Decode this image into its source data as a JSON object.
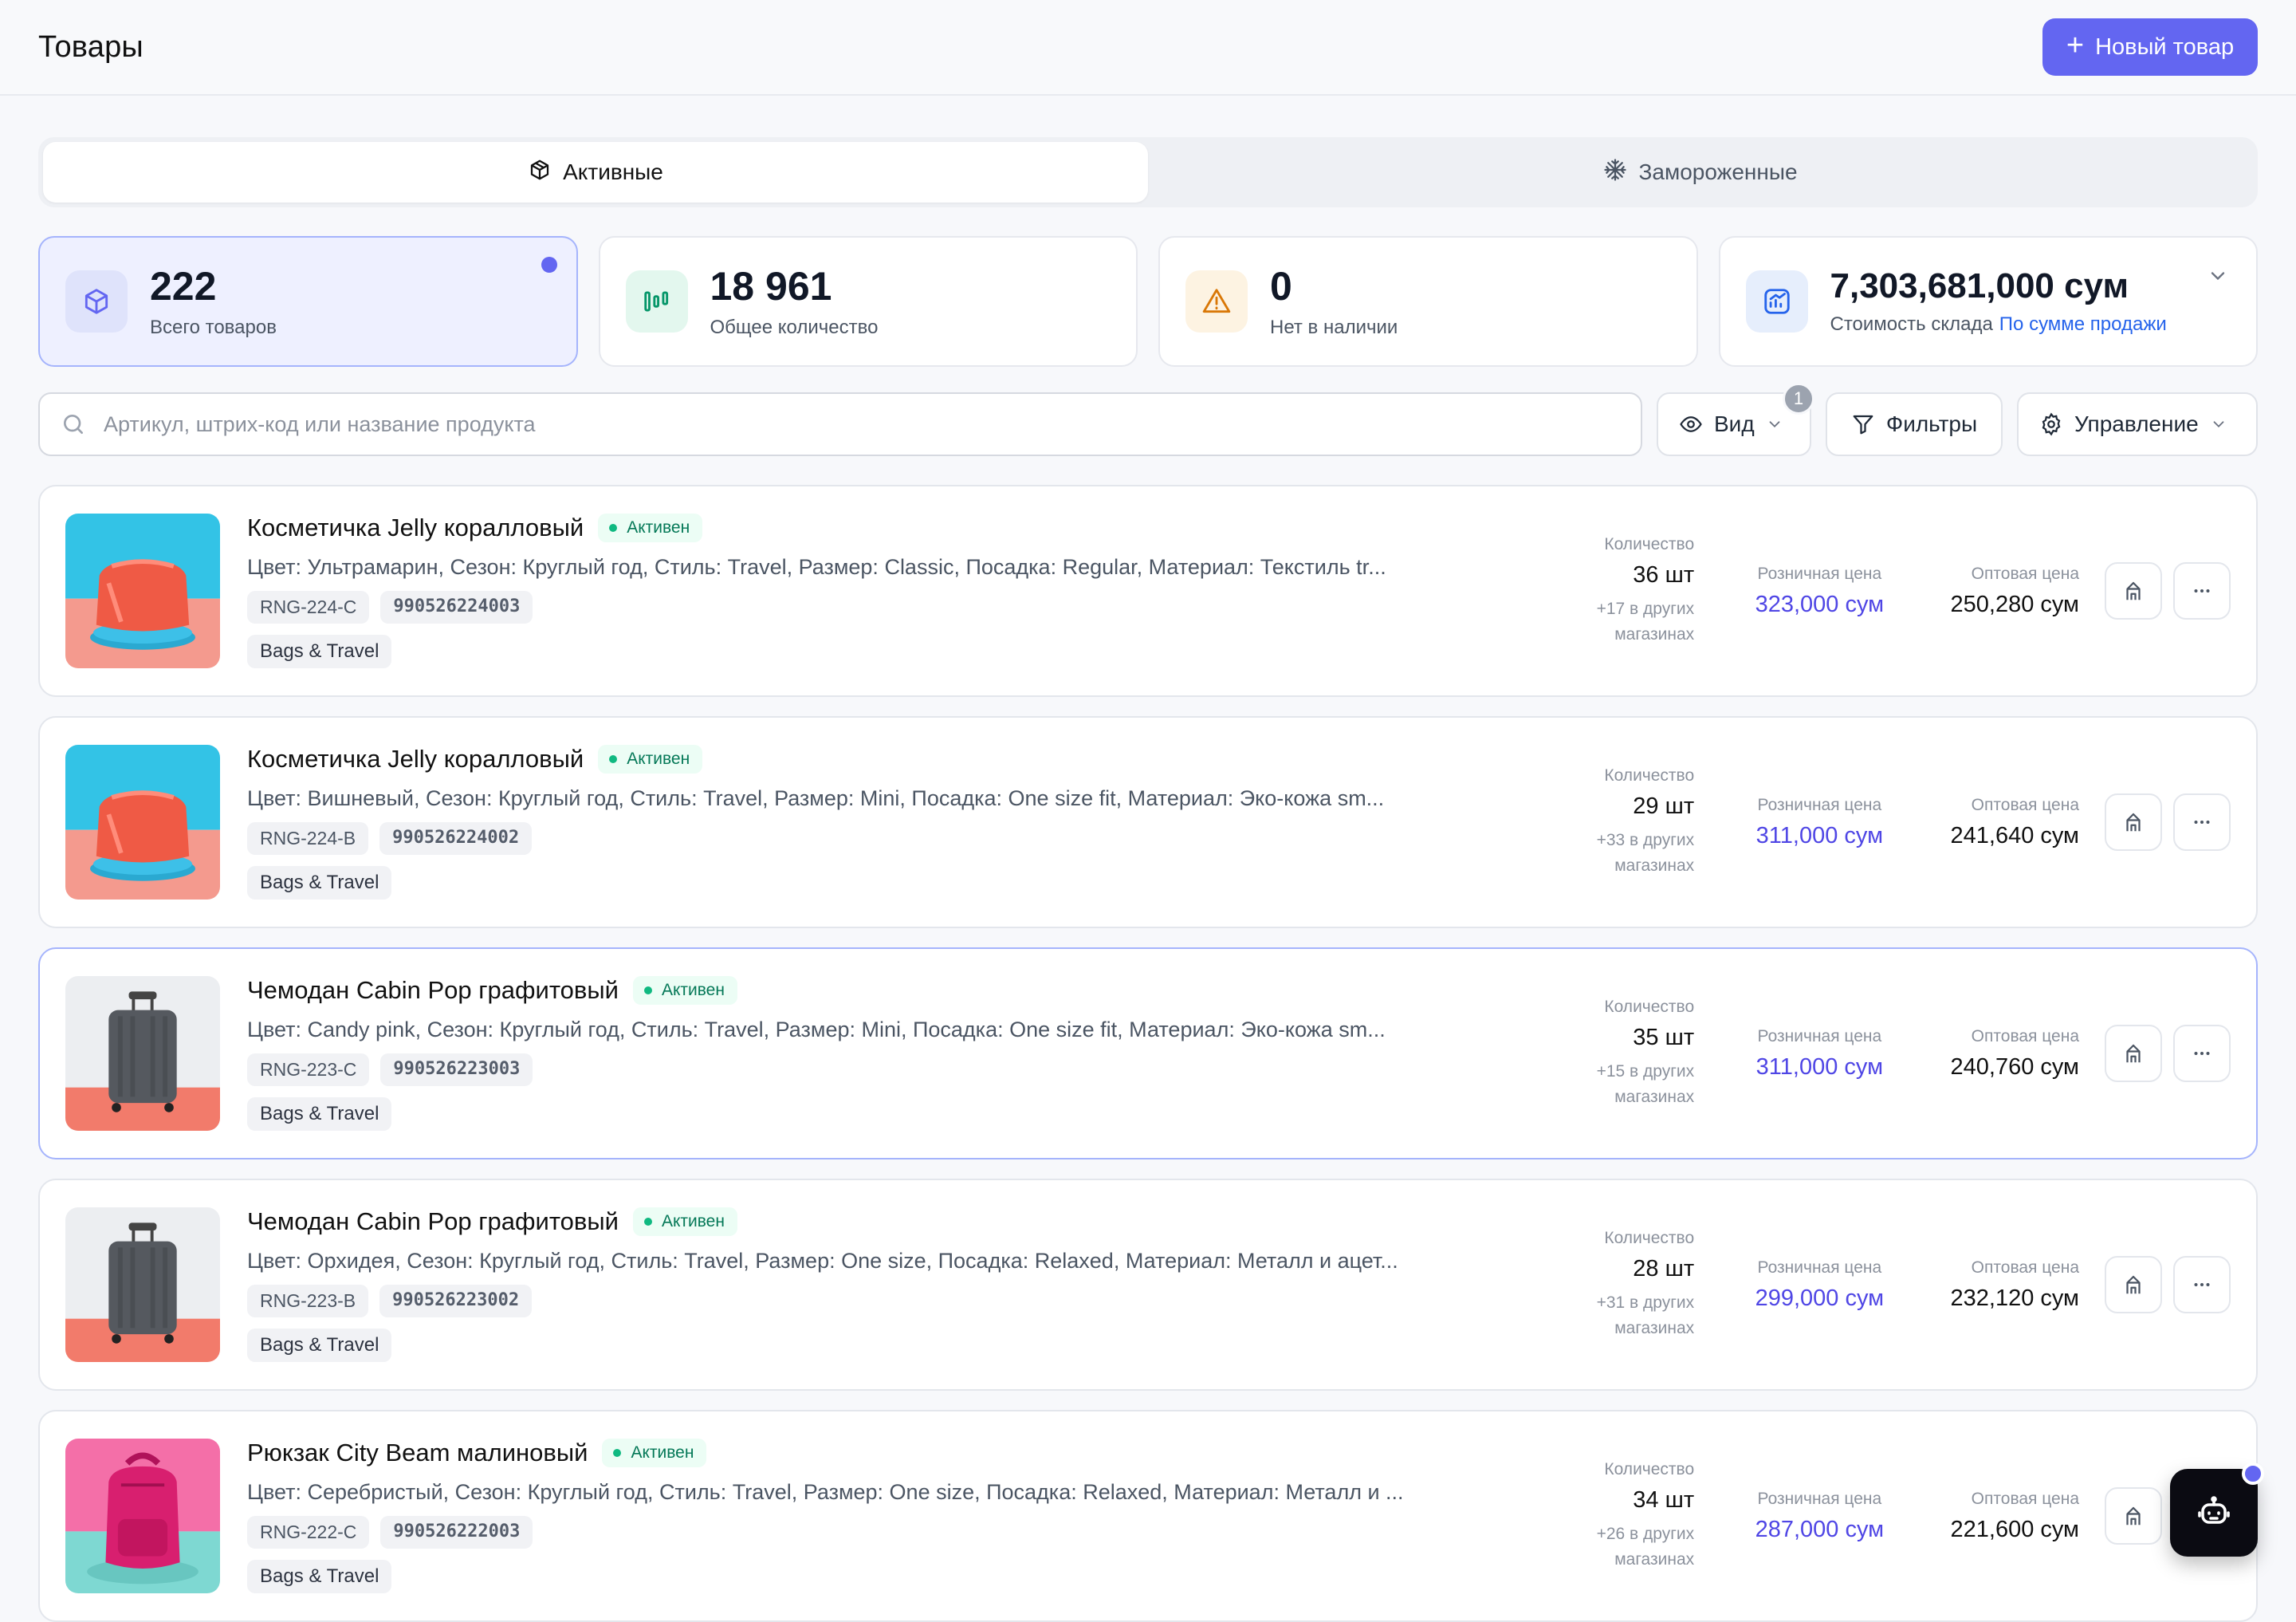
{
  "header": {
    "title": "Товары",
    "new_button_label": "Новый товар"
  },
  "tabs": [
    {
      "label": "Активные",
      "icon": "box-icon",
      "active": true
    },
    {
      "label": "Замороженные",
      "icon": "snowflake-icon",
      "active": false
    }
  ],
  "stats": [
    {
      "value": "222",
      "label": "Всего товаров",
      "icon": "cube-icon",
      "selected": true
    },
    {
      "value": "18 961",
      "label": "Общее количество",
      "icon": "quantity-icon"
    },
    {
      "value": "0",
      "label": "Нет в наличии",
      "icon": "warning-icon"
    },
    {
      "value": "7,303,681,000 сум",
      "label": "Стоимость склада",
      "link": "По сумме продажи",
      "icon": "chart-icon"
    }
  ],
  "toolbar": {
    "search_placeholder": "Артикул, штрих-код или название продукта",
    "view_label": "Вид",
    "view_badge": "1",
    "filters_label": "Фильтры",
    "manage_label": "Управление"
  },
  "columns": {
    "quantity": "Количество",
    "retail": "Розничная цена",
    "wholesale": "Оптовая цена"
  },
  "products": [
    {
      "name": "Косметичка Jelly коралловый",
      "status": "Активен",
      "attributes": "Цвет: Ультрамарин, Сезон: Круглый год, Стиль: Travel, Размер: Classic, Посадка: Regular, Материал: Текстиль tr...",
      "sku": "RNG-224-C",
      "barcode": "990526224003",
      "category": "Bags & Travel",
      "quantity": "36 шт",
      "other_stores": "+17 в других магазинах",
      "retail_price": "323,000 сум",
      "wholesale_price": "250,280 сум",
      "image": "cosmetic-bag"
    },
    {
      "name": "Косметичка Jelly коралловый",
      "status": "Активен",
      "attributes": "Цвет: Вишневый, Сезон: Круглый год, Стиль: Travel, Размер: Mini, Посадка: One size fit, Материал: Эко-кожа sm...",
      "sku": "RNG-224-B",
      "barcode": "990526224002",
      "category": "Bags & Travel",
      "quantity": "29 шт",
      "other_stores": "+33 в других магазинах",
      "retail_price": "311,000 сум",
      "wholesale_price": "241,640 сум",
      "image": "cosmetic-bag"
    },
    {
      "name": "Чемодан Cabin Pop графитовый",
      "status": "Активен",
      "attributes": "Цвет: Candy pink, Сезон: Круглый год, Стиль: Travel, Размер: Mini, Посадка: One size fit, Материал: Эко-кожа sm...",
      "sku": "RNG-223-C",
      "barcode": "990526223003",
      "category": "Bags & Travel",
      "quantity": "35 шт",
      "other_stores": "+15 в других магазинах",
      "retail_price": "311,000 сум",
      "wholesale_price": "240,760 сум",
      "image": "suitcase",
      "highlight": true
    },
    {
      "name": "Чемодан Cabin Pop графитовый",
      "status": "Активен",
      "attributes": "Цвет: Орхидея, Сезон: Круглый год, Стиль: Travel, Размер: One size, Посадка: Relaxed, Материал: Металл и ацет...",
      "sku": "RNG-223-B",
      "barcode": "990526223002",
      "category": "Bags & Travel",
      "quantity": "28 шт",
      "other_stores": "+31 в других магазинах",
      "retail_price": "299,000 сум",
      "wholesale_price": "232,120 сум",
      "image": "suitcase"
    },
    {
      "name": "Рюкзак City Beam малиновый",
      "status": "Активен",
      "attributes": "Цвет: Серебристый, Сезон: Круглый год, Стиль: Travel, Размер: One size, Посадка: Relaxed, Материал: Металл и ...",
      "sku": "RNG-222-C",
      "barcode": "990526222003",
      "category": "Bags & Travel",
      "quantity": "34 шт",
      "other_stores": "+26 в других магазинах",
      "retail_price": "287,000 сум",
      "wholesale_price": "221,600 сум",
      "image": "backpack"
    }
  ],
  "colors": {
    "accent": "#6366f1",
    "retail_price": "#4f46e5",
    "status_green": "#10b981",
    "link": "#2563eb"
  }
}
